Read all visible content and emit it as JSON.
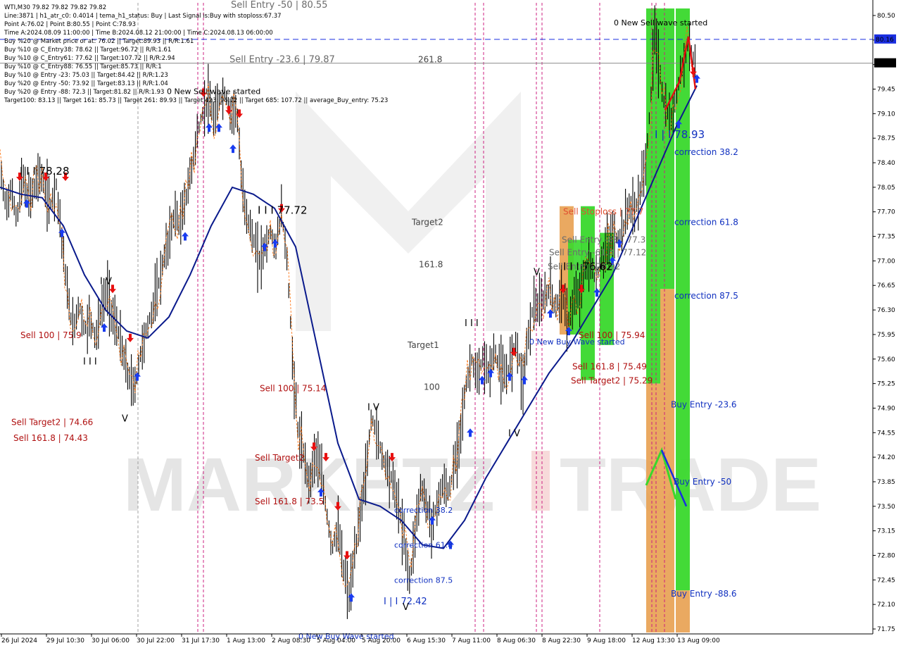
{
  "header": {
    "title": "WTI,M30  79.82 79.82 79.82 79.82",
    "info_lines": [
      "Line:3871 | h1_atr_c0: 0.4014 | tema_h1_status: Buy | Last Signal is:Buy with stoploss:67.37",
      "Point A:76.02 | Point B:80.55 | Point C:78.93",
      "Time A:2024.08.09 11:00:00 | Time B:2024.08.12 21:00:00 | Time C:2024.08.13 06:00:00",
      "Buy %20 @ Market price or at: 76.02 || Target:89.93 || R/R:1.61",
      "Buy %10 @ C_Entry38: 78.62 || Target:96.72 || R/R:1.61",
      "Buy %10 @ C_Entry61: 77.62 || Target:107.72 || R/R:2.94",
      "Buy %10 @ C_Entry88: 76.55 || Target:85.73 || R/R:1",
      "Buy %10 @ Entry -23: 75.03 || Target:84.42 || R/R:1.23",
      "Buy %20 @ Entry -50: 73.92 || Target:83.13 || R/R:1.04",
      "Buy %20 @ Entry -88: 72.3 || Target:81.82 || R/R:1.93",
      "Target100: 83.13 || Target 161: 85.73 || Target 261: 89.93 || Target 423: 96.72 || Target 685: 107.72 || average_Buy_entry: 75.23"
    ]
  },
  "colors": {
    "background": "#ffffff",
    "candles": "#000000",
    "ma": "#0a1a8c",
    "orange_line": "#ff6a00",
    "sell_text": "#b01010",
    "buy_text": "#1030c0",
    "green_zone": "#39d82c",
    "orange_zone": "#e8a050",
    "price_marker_blue": "#1a2ee0",
    "current_price_bg": "#000000",
    "watermark": "#d8d8d8"
  },
  "price_markers": {
    "current_price": "79.82",
    "level_price": "80.16"
  },
  "chart_labels": {
    "sell_labels": [
      {
        "text": "Sell Entry -50 | 80.55",
        "price": 80.55
      },
      {
        "text": "Sell Entry -23.6 | 79.87",
        "price": 79.87
      },
      {
        "text": "Sell 100 | 75.9",
        "price": 75.9
      },
      {
        "text": "Sell Target2 | 74.66",
        "price": 74.66
      },
      {
        "text": "Sell 161.8 | 74.43",
        "price": 74.43
      },
      {
        "text": "Sell 100 | 75.14",
        "price": 75.14
      },
      {
        "text": "Sell Target2",
        "price": 74.15
      },
      {
        "text": "Sell 161.8 | 73.5",
        "price": 73.53
      },
      {
        "text": "Sell Stoploss | 77.7",
        "price": 77.7
      },
      {
        "text": "Sell Entry -88 | 77.3",
        "price": 77.3
      },
      {
        "text": "Sell Entry -61.8 | 77.12",
        "price": 77.12
      },
      {
        "text": "Sell Entry | 76.92",
        "price": 76.92
      },
      {
        "text": "Sell 100 | 75.94",
        "price": 75.94
      },
      {
        "text": "Sell 161.8 | 75.49",
        "price": 75.49
      },
      {
        "text": "Sell Target2 | 75.29",
        "price": 75.29
      }
    ],
    "buy_labels": [
      {
        "text": "correction 38.2",
        "price": 78.55
      },
      {
        "text": "correction 61.8",
        "price": 77.55
      },
      {
        "text": "correction 87.5",
        "price": 76.5
      },
      {
        "text": "Buy Entry -23.6",
        "price": 74.95
      },
      {
        "text": "Buy Entry -50",
        "price": 73.85
      },
      {
        "text": "Buy Entry -88.6",
        "price": 72.25
      },
      {
        "text": "correction 38.2",
        "price": 73.45
      },
      {
        "text": "correction 61.8",
        "price": 72.95
      },
      {
        "text": "correction 87.5",
        "price": 72.45
      },
      {
        "text": "0 New Buy Wave started",
        "price": 75.85
      },
      {
        "text": "0 New Buy Wave started",
        "price": 71.65
      }
    ],
    "wave_labels": [
      {
        "text": "0 New Sell wave started",
        "price": 80.4
      },
      {
        "text": "0 New Sell wave started",
        "price": 79.42
      }
    ],
    "fib_labels": [
      {
        "text": "261.8",
        "price": 79.87
      },
      {
        "text": "Target2",
        "price": 77.55
      },
      {
        "text": "161.8",
        "price": 76.95
      },
      {
        "text": "Target1",
        "price": 75.8
      },
      {
        "text": "100",
        "price": 75.2
      }
    ],
    "wave_counts": [
      {
        "text": "I I I 78.28",
        "price": 78.28
      },
      {
        "text": "I I I 77.72",
        "price": 77.72
      },
      {
        "text": "I V",
        "price": 76.72
      },
      {
        "text": "I I I",
        "price": 75.57
      },
      {
        "text": "V",
        "price": 74.76
      },
      {
        "text": "I V",
        "price": 74.92
      },
      {
        "text": "I I I",
        "price": 76.12
      },
      {
        "text": "I V",
        "price": 74.55
      },
      {
        "text": "V",
        "price": 76.85
      },
      {
        "text": "I I I 76.62",
        "price": 76.92
      },
      {
        "text": "I | I 78.93",
        "price": 78.8
      },
      {
        "text": "I | I 72.42",
        "price": 72.15
      },
      {
        "text": "V",
        "price": 72.07
      }
    ]
  },
  "chart_data": {
    "type": "candlestick",
    "title": "WTI,M30",
    "y_axis": {
      "range": [
        71.7,
        80.6
      ],
      "ticks": [
        "80.50",
        "80.15",
        "79.80",
        "79.45",
        "79.10",
        "78.75",
        "78.40",
        "78.05",
        "77.70",
        "77.35",
        "77.00",
        "76.65",
        "76.30",
        "75.95",
        "75.60",
        "75.25",
        "74.90",
        "74.55",
        "74.20",
        "73.85",
        "73.50",
        "73.15",
        "72.80",
        "72.45",
        "72.10",
        "71.75"
      ]
    },
    "x_axis": {
      "ticks": [
        "26 Jul 2024",
        "29 Jul 10:30",
        "30 Jul 06:00",
        "30 Jul 22:00",
        "31 Jul 17:30",
        "1 Aug 13:00",
        "2 Aug 08:30",
        "5 Aug 04:00",
        "5 Aug 20:00",
        "6 Aug 15:30",
        "7 Aug 11:00",
        "8 Aug 06:30",
        "8 Aug 22:30",
        "9 Aug 18:00",
        "12 Aug 13:30",
        "13 Aug 09:00"
      ]
    },
    "price_path": [
      [
        0,
        78.3
      ],
      [
        8,
        77.8
      ],
      [
        16,
        78.0
      ],
      [
        24,
        77.6
      ],
      [
        32,
        78.2
      ],
      [
        40,
        77.9
      ],
      [
        48,
        78.0
      ],
      [
        56,
        78.28
      ],
      [
        64,
        78.0
      ],
      [
        72,
        77.8
      ],
      [
        80,
        78.1
      ],
      [
        88,
        77.3
      ],
      [
        96,
        76.5
      ],
      [
        104,
        76.0
      ],
      [
        112,
        76.4
      ],
      [
        120,
        76.0
      ],
      [
        128,
        76.2
      ],
      [
        136,
        75.9
      ],
      [
        144,
        76.3
      ],
      [
        152,
        76.6
      ],
      [
        160,
        76.2
      ],
      [
        168,
        76.0
      ],
      [
        176,
        75.6
      ],
      [
        184,
        75.3
      ],
      [
        192,
        75.2
      ],
      [
        200,
        75.7
      ],
      [
        208,
        76.0
      ],
      [
        216,
        76.3
      ],
      [
        224,
        76.6
      ],
      [
        232,
        77.0
      ],
      [
        240,
        77.3
      ],
      [
        248,
        77.7
      ],
      [
        256,
        77.5
      ],
      [
        264,
        77.9
      ],
      [
        272,
        78.3
      ],
      [
        280,
        78.8
      ],
      [
        288,
        79.1
      ],
      [
        296,
        79.3
      ],
      [
        304,
        79.0
      ],
      [
        312,
        79.3
      ],
      [
        320,
        79.4
      ],
      [
        328,
        79.1
      ],
      [
        336,
        79.2
      ],
      [
        344,
        78.0
      ],
      [
        352,
        77.6
      ],
      [
        360,
        77.3
      ],
      [
        368,
        77.0
      ],
      [
        376,
        77.2
      ],
      [
        384,
        77.4
      ],
      [
        392,
        77.2
      ],
      [
        400,
        77.7
      ],
      [
        408,
        77.0
      ],
      [
        416,
        75.5
      ],
      [
        424,
        74.5
      ],
      [
        432,
        74.2
      ],
      [
        440,
        73.8
      ],
      [
        448,
        74.3
      ],
      [
        456,
        74.0
      ],
      [
        464,
        73.4
      ],
      [
        472,
        72.9
      ],
      [
        480,
        73.2
      ],
      [
        488,
        72.6
      ],
      [
        496,
        72.2
      ],
      [
        504,
        72.8
      ],
      [
        512,
        73.4
      ],
      [
        520,
        74.0
      ],
      [
        528,
        74.8
      ],
      [
        536,
        74.5
      ],
      [
        544,
        74.2
      ],
      [
        552,
        74.0
      ],
      [
        560,
        73.8
      ],
      [
        568,
        73.4
      ],
      [
        576,
        72.9
      ],
      [
        582,
        72.42
      ],
      [
        590,
        73.2
      ],
      [
        598,
        73.8
      ],
      [
        606,
        73.5
      ],
      [
        614,
        73.2
      ],
      [
        622,
        73.6
      ],
      [
        630,
        73.8
      ],
      [
        638,
        73.7
      ],
      [
        646,
        74.1
      ],
      [
        654,
        74.6
      ],
      [
        662,
        75.2
      ],
      [
        670,
        75.6
      ],
      [
        678,
        75.3
      ],
      [
        686,
        75.6
      ],
      [
        694,
        75.4
      ],
      [
        702,
        75.7
      ],
      [
        710,
        75.5
      ],
      [
        718,
        75.3
      ],
      [
        726,
        75.6
      ],
      [
        734,
        75.9
      ],
      [
        742,
        75.2
      ],
      [
        750,
        75.9
      ],
      [
        758,
        76.4
      ],
      [
        766,
        76.3
      ],
      [
        774,
        76.5
      ],
      [
        782,
        76.6
      ],
      [
        790,
        76.3
      ],
      [
        798,
        76.6
      ],
      [
        806,
        76.1
      ],
      [
        814,
        76.4
      ],
      [
        822,
        76.5
      ],
      [
        830,
        76.8
      ],
      [
        838,
        77.0
      ],
      [
        846,
        76.7
      ],
      [
        854,
        77.0
      ],
      [
        862,
        77.2
      ],
      [
        870,
        77.4
      ],
      [
        878,
        77.3
      ],
      [
        886,
        77.5
      ],
      [
        894,
        77.8
      ],
      [
        902,
        77.7
      ],
      [
        910,
        78.0
      ],
      [
        918,
        78.5
      ],
      [
        924,
        79.2
      ],
      [
        930,
        80.3
      ],
      [
        936,
        79.8
      ],
      [
        942,
        79.3
      ],
      [
        948,
        79.1
      ],
      [
        954,
        79.0
      ],
      [
        960,
        79.3
      ],
      [
        966,
        79.7
      ],
      [
        972,
        79.8
      ],
      [
        978,
        80.2
      ],
      [
        984,
        79.9
      ],
      [
        990,
        79.82
      ]
    ],
    "moving_average": [
      [
        0,
        78.05
      ],
      [
        30,
        77.95
      ],
      [
        60,
        77.9
      ],
      [
        90,
        77.5
      ],
      [
        120,
        76.8
      ],
      [
        150,
        76.3
      ],
      [
        180,
        76.0
      ],
      [
        210,
        75.9
      ],
      [
        240,
        76.2
      ],
      [
        270,
        76.8
      ],
      [
        300,
        77.5
      ],
      [
        330,
        78.05
      ],
      [
        360,
        77.95
      ],
      [
        390,
        77.75
      ],
      [
        420,
        77.2
      ],
      [
        450,
        75.8
      ],
      [
        480,
        74.4
      ],
      [
        510,
        73.6
      ],
      [
        540,
        73.5
      ],
      [
        570,
        73.3
      ],
      [
        600,
        72.95
      ],
      [
        630,
        72.9
      ],
      [
        660,
        73.3
      ],
      [
        690,
        73.9
      ],
      [
        720,
        74.4
      ],
      [
        750,
        74.9
      ],
      [
        780,
        75.4
      ],
      [
        810,
        75.8
      ],
      [
        840,
        76.3
      ],
      [
        870,
        76.8
      ],
      [
        900,
        77.5
      ],
      [
        930,
        78.2
      ],
      [
        960,
        78.9
      ],
      [
        990,
        79.5
      ]
    ],
    "sell_levels": [
      {
        "label": "Sell Stoploss",
        "value": 77.7
      },
      {
        "label": "Sell Entry",
        "value": 76.92
      },
      {
        "label": "Sell 100",
        "value": 75.94
      },
      {
        "label": "Sell 161.8",
        "value": 75.49
      },
      {
        "label": "Sell Target2",
        "value": 75.29
      }
    ],
    "buy_levels": [
      {
        "label": "correction 38.2",
        "value": 78.62
      },
      {
        "label": "correction 61.8",
        "value": 77.62
      },
      {
        "label": "correction 87.5",
        "value": 76.55
      },
      {
        "label": "Buy Entry -23.6",
        "value": 75.03
      },
      {
        "label": "Buy Entry -50",
        "value": 73.92
      },
      {
        "label": "Buy Entry -88.6",
        "value": 72.3
      }
    ],
    "grid": false,
    "legend": "none"
  }
}
